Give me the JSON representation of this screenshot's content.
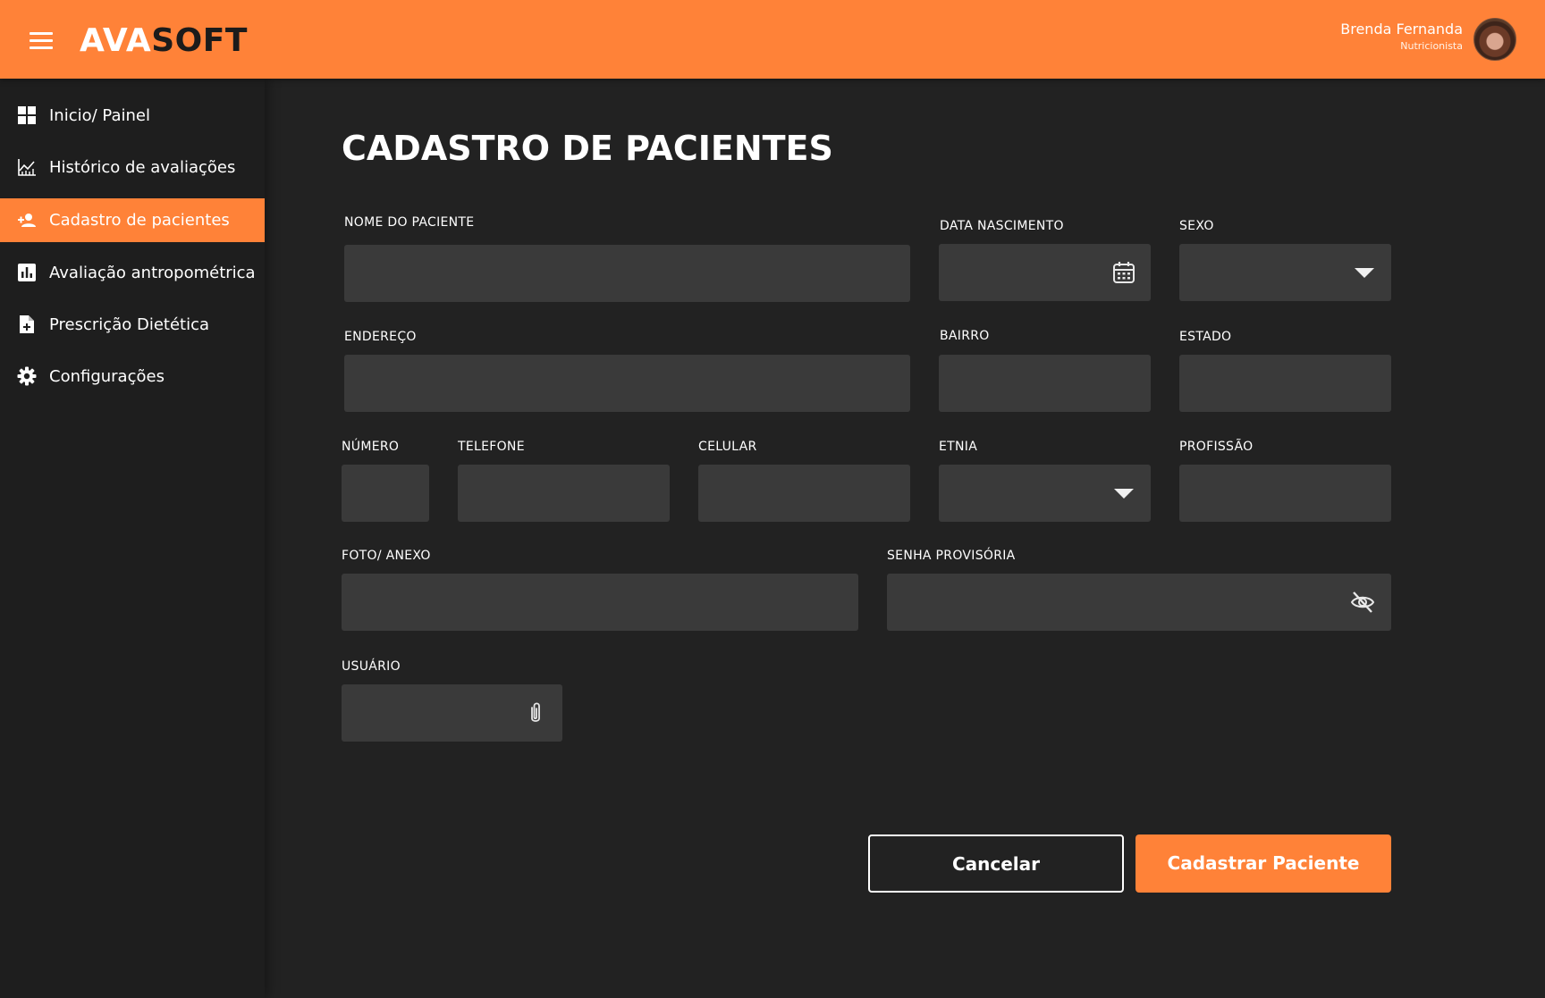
{
  "header": {
    "logo_part1": "AVA",
    "logo_part2": "SOFT",
    "user_name": "Brenda Fernanda",
    "user_role": "Nutricionista"
  },
  "sidebar": {
    "items": [
      {
        "label": "Inicio/ Painel",
        "icon": "dashboard-icon",
        "active": false
      },
      {
        "label": "Histórico de avaliações",
        "icon": "chart-icon",
        "active": false
      },
      {
        "label": "Cadastro de pacientes",
        "icon": "person-add-icon",
        "active": true
      },
      {
        "label": "Avaliação antropométrica",
        "icon": "bar-chart-icon",
        "active": false
      },
      {
        "label": "Prescrição Dietética",
        "icon": "document-add-icon",
        "active": false
      },
      {
        "label": "Configurações",
        "icon": "gear-icon",
        "active": false
      }
    ]
  },
  "main": {
    "title": "CADASTRO DE PACIENTES",
    "fields": {
      "nome": {
        "label": "NOME DO PACIENTE",
        "value": ""
      },
      "nascimento": {
        "label": "DATA NASCIMENTO",
        "value": ""
      },
      "sexo": {
        "label": "SEXO",
        "value": ""
      },
      "endereco": {
        "label": "ENDEREÇO",
        "value": ""
      },
      "bairro": {
        "label": "BAIRRO",
        "value": ""
      },
      "estado": {
        "label": "ESTADO",
        "value": ""
      },
      "numero": {
        "label": "NÚMERO",
        "value": ""
      },
      "telefone": {
        "label": "TELEFONE",
        "value": ""
      },
      "celular": {
        "label": "CELULAR",
        "value": ""
      },
      "etnia": {
        "label": "ETNIA",
        "value": ""
      },
      "profissao": {
        "label": "PROFISSÃO",
        "value": ""
      },
      "foto": {
        "label": "FOTO/ ANEXO",
        "value": ""
      },
      "senha": {
        "label": "SENHA PROVISÓRIA",
        "value": ""
      },
      "usuario": {
        "label": "USUÁRIO",
        "value": ""
      }
    },
    "buttons": {
      "cancel": "Cancelar",
      "submit": "Cadastrar Paciente"
    }
  },
  "colors": {
    "accent": "#ff8238",
    "background": "#222222",
    "sidebar": "#1e1e1e",
    "field": "#3a3a3a"
  }
}
